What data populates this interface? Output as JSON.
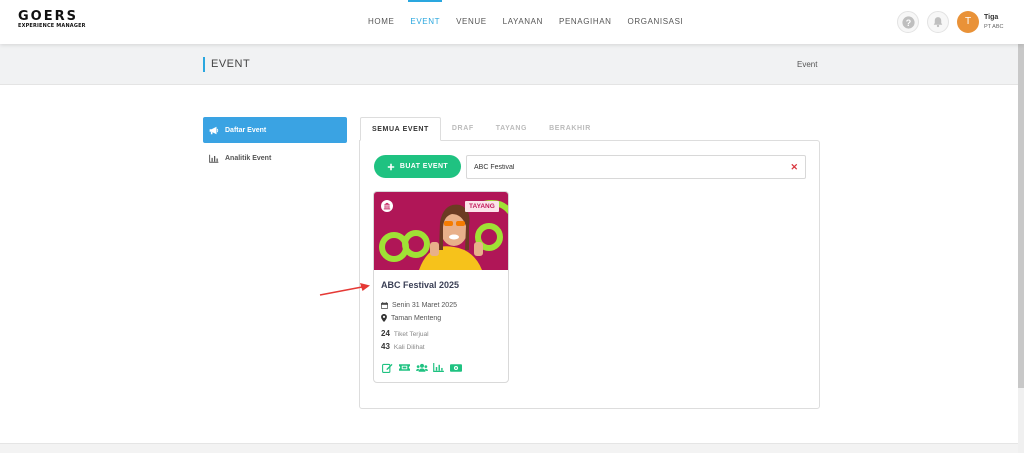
{
  "brand": {
    "name": "GOERS",
    "tagline": "EXPERIENCE MANAGER"
  },
  "nav": [
    {
      "label": "HOME",
      "active": false
    },
    {
      "label": "EVENT",
      "active": true
    },
    {
      "label": "VENUE",
      "active": false
    },
    {
      "label": "LAYANAN",
      "active": false
    },
    {
      "label": "PENAGIHAN",
      "active": false
    },
    {
      "label": "ORGANISASI",
      "active": false
    }
  ],
  "user": {
    "initial": "T",
    "name": "Tiga",
    "org": "PT ABC"
  },
  "header": {
    "title": "EVENT",
    "breadcrumb": "Event"
  },
  "sidebar": {
    "items": [
      {
        "label": "Daftar Event",
        "icon": "megaphone-icon",
        "active": true
      },
      {
        "label": "Analitik Event",
        "icon": "bar-chart-icon",
        "active": false
      }
    ]
  },
  "tabs": [
    {
      "label": "SEMUA EVENT",
      "active": true
    },
    {
      "label": "DRAF",
      "active": false
    },
    {
      "label": "TAYANG",
      "active": false
    },
    {
      "label": "BERAKHIR",
      "active": false
    }
  ],
  "toolbar": {
    "create_label": "BUAT EVENT",
    "search_value": "ABC Festival"
  },
  "event_card": {
    "status": "TAYANG",
    "title": "ABC Festival 2025",
    "date": "Senin 31 Maret 2025",
    "location": "Taman Menteng",
    "tickets_sold": "24",
    "tickets_sold_label": "Tiket Terjual",
    "views": "43",
    "views_label": "Kali Dilihat",
    "actions": [
      "edit-icon",
      "ticket-icon",
      "users-icon",
      "analytics-icon",
      "money-icon"
    ]
  },
  "colors": {
    "accent": "#2aa7df",
    "sidebar_active": "#3aa3e3",
    "primary_green": "#1fc281",
    "danger": "#d9363e",
    "card_bg": "#c2185b"
  }
}
